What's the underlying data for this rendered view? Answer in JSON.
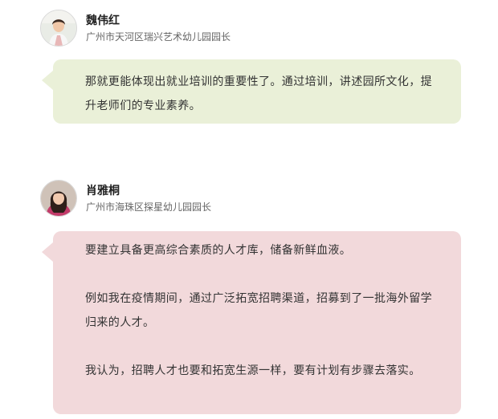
{
  "sections": [
    {
      "speaker": {
        "name": "魏伟红",
        "title": "广州市天河区瑞兴艺术幼儿园园长",
        "avatar_icon": "person-portrait-icon"
      },
      "bubble_color": "#eaf0d8",
      "paragraphs": [
        "那就更能体现出就业培训的重要性了。通过培训，讲述园所文化，提升老师们的专业素养。"
      ]
    },
    {
      "speaker": {
        "name": "肖雅桐",
        "title": "广州市海珠区探星幼儿园园长",
        "avatar_icon": "person-portrait-icon"
      },
      "bubble_color": "#f2d9db",
      "paragraphs": [
        "要建立具备更高综合素质的人才库，储备新鲜血液。",
        "例如我在疫情期间，通过广泛拓宽招聘渠道，招募到了一批海外留学归来的人才。",
        "我认为，招聘人才也要和拓宽生源一样，要有计划有步骤去落实。"
      ]
    }
  ]
}
